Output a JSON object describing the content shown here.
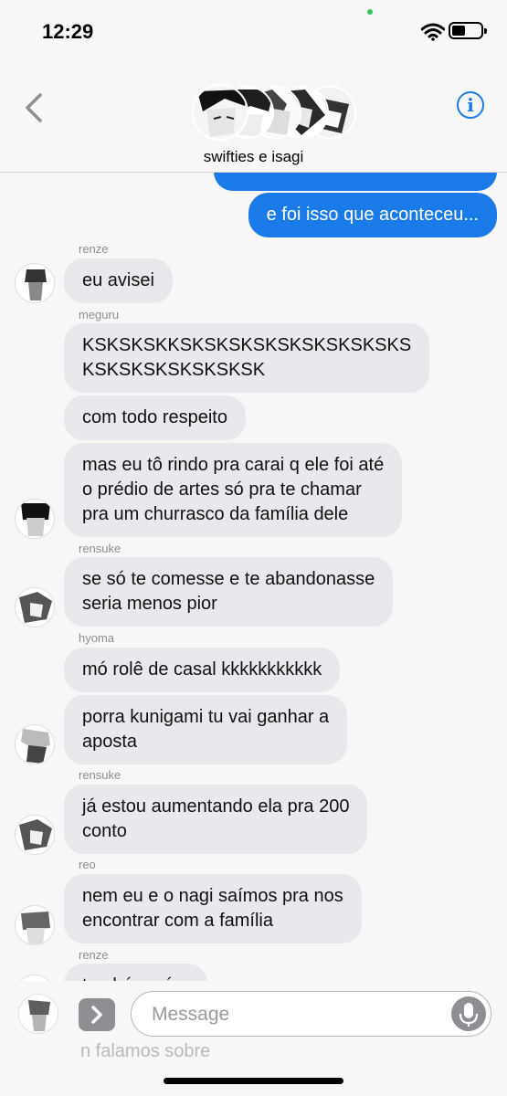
{
  "status": {
    "time": "12:29"
  },
  "header": {
    "group_name": "swifties e isagi",
    "info_symbol": "i"
  },
  "messages": {
    "out1": "e foi isso que aconteceu...",
    "renze1": {
      "sender": "renze",
      "text": "eu avisei"
    },
    "meguru1": {
      "sender": "meguru",
      "text": "KSKSKSKKSKSKSKSKSKSKSKSKSKS\nKSKSKSKSKSKSKSK"
    },
    "meguru2": "com todo respeito",
    "meguru3": "mas eu tô rindo pra carai q ele foi até\no prédio de artes só pra te chamar\npra um churrasco da família  dele",
    "rensuke1": {
      "sender": "rensuke",
      "text": "se só te comesse e te abandonasse\nseria menos pior"
    },
    "hyoma1": {
      "sender": "hyoma",
      "text": "mó rolê de casal kkkkkkkkkkk"
    },
    "hyoma2": "porra kunigami tu vai ganhar a\naposta",
    "rensuke2": {
      "sender": "rensuke",
      "text": "já estou aumentando ela pra 200\nconto"
    },
    "reo1": {
      "sender": "reo",
      "text": "nem eu e o nagi saímos pra nos\nencontrar com a família"
    },
    "renze2": {
      "sender": "renze",
      "text": "também né..."
    },
    "partial_below": "n falamos sobre"
  },
  "input": {
    "placeholder": "Message"
  },
  "colors": {
    "outgoing": "#1a7be8",
    "incoming": "#e8e8ed",
    "accent": "#1a7be8"
  }
}
